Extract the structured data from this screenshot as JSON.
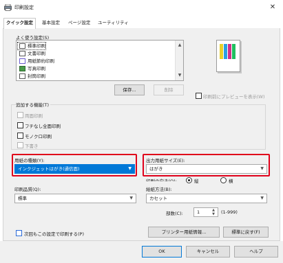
{
  "window": {
    "title": "印刷設定",
    "close_glyph": "✕"
  },
  "tabs": [
    {
      "label": "クイック設定"
    },
    {
      "label": "基本設定"
    },
    {
      "label": "ページ設定"
    },
    {
      "label": "ユーティリティ"
    }
  ],
  "favorites": {
    "label": "よく使う設定(S)",
    "items": [
      {
        "label": "標準印刷"
      },
      {
        "label": "文書印刷"
      },
      {
        "label": "用紙節約印刷"
      },
      {
        "label": "写真印刷"
      },
      {
        "label": "封筒印刷"
      }
    ],
    "save_button": "保存...",
    "delete_button": "削除"
  },
  "preview": {
    "checkbox_label": "印刷前にプレビューを表示(W)"
  },
  "added_functions": {
    "label": "追加する機能(T)",
    "items": [
      {
        "label": "両面印刷",
        "enabled": false
      },
      {
        "label": "フチなし全面印刷",
        "enabled": true
      },
      {
        "label": "モノクロ印刷",
        "enabled": true
      },
      {
        "label": "下書き",
        "enabled": false
      }
    ]
  },
  "media_type": {
    "label": "用紙の種類(Y):",
    "value": "インクジェットはがき(通信面)"
  },
  "paper_size": {
    "label": "出力用紙サイズ(E):",
    "value": "はがき"
  },
  "orientation": {
    "label": "印刷の向き(O):",
    "portrait": "縦",
    "landscape": "横"
  },
  "print_quality": {
    "label": "印刷品質(Q):",
    "value": "標準"
  },
  "paper_source": {
    "label": "給紙方法(B):",
    "value": "カセット"
  },
  "copies": {
    "label": "部数(C):",
    "value": "1",
    "range": "(1-999)"
  },
  "always_print_current": {
    "label": "次回もこの設定で印刷する(P)"
  },
  "printer_media_info_button": "プリンター用紙情報...",
  "defaults_button": "標準に戻す(F)",
  "footer": {
    "ok": "OK",
    "cancel": "キャンセル",
    "help": "ヘルプ"
  },
  "colors": {
    "accent": "#0078d7",
    "highlight_border": "#e0001a"
  }
}
